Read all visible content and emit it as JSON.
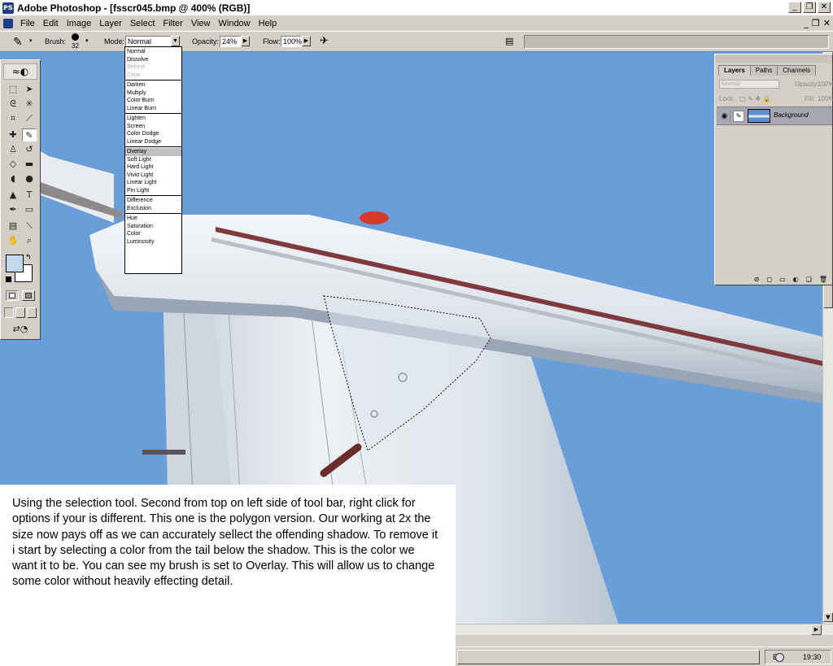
{
  "window": {
    "title": "Adobe Photoshop - [fsscr045.bmp @ 400% (RGB)]",
    "app_icon": "photoshop-icon",
    "controls": [
      "_",
      "❐",
      "✕"
    ]
  },
  "menubar": {
    "items": [
      "File",
      "Edit",
      "Image",
      "Layer",
      "Select",
      "Filter",
      "View",
      "Window",
      "Help"
    ],
    "doc_controls": [
      "_",
      "❐",
      "✕"
    ]
  },
  "options": {
    "brush_label": "Brush:",
    "brush_size": "32",
    "mode_label": "Mode:",
    "mode_value": "Normal",
    "opacity_label": "Opacity:",
    "opacity_value": "24%",
    "flow_label": "Flow:",
    "flow_value": "100%"
  },
  "blend_modes": {
    "groups": [
      [
        {
          "label": "Normal",
          "state": "normal"
        },
        {
          "label": "Dissolve",
          "state": "normal"
        },
        {
          "label": "Behind",
          "state": "disabled"
        },
        {
          "label": "Clear",
          "state": "disabled"
        }
      ],
      [
        {
          "label": "Darken",
          "state": "normal"
        },
        {
          "label": "Multiply",
          "state": "normal"
        },
        {
          "label": "Color Burn",
          "state": "normal"
        },
        {
          "label": "Linear Burn",
          "state": "normal"
        }
      ],
      [
        {
          "label": "Lighten",
          "state": "normal"
        },
        {
          "label": "Screen",
          "state": "normal"
        },
        {
          "label": "Color Dodge",
          "state": "normal"
        },
        {
          "label": "Linear Dodge",
          "state": "normal"
        }
      ],
      [
        {
          "label": "Overlay",
          "state": "selected"
        },
        {
          "label": "Soft Light",
          "state": "normal"
        },
        {
          "label": "Hard Light",
          "state": "normal"
        },
        {
          "label": "Vivid Light",
          "state": "normal"
        },
        {
          "label": "Linear Light",
          "state": "normal"
        },
        {
          "label": "Pin Light",
          "state": "normal"
        }
      ],
      [
        {
          "label": "Difference",
          "state": "normal"
        },
        {
          "label": "Exclusion",
          "state": "normal"
        }
      ],
      [
        {
          "label": "Hue",
          "state": "normal"
        },
        {
          "label": "Saturation",
          "state": "normal"
        },
        {
          "label": "Color",
          "state": "normal"
        },
        {
          "label": "Luminosity",
          "state": "normal"
        }
      ]
    ]
  },
  "layers_palette": {
    "tabs": [
      "Layers",
      "Paths",
      "Channels"
    ],
    "blend_value": "Normal",
    "opacity_label": "Opacity:",
    "opacity_value": "100%",
    "lock_label": "Lock:",
    "fill_label": "Fill:",
    "fill_value": "100%",
    "layers": [
      {
        "name": "Background"
      }
    ]
  },
  "colors": {
    "foreground": "#c3d8ec",
    "background": "#ffffff",
    "sky": "#6a9ed8"
  },
  "caption": {
    "text": "Using the selection tool. Second from top on left side of tool bar, right click for options if your is different. This one is the polygon version. Our working at 2x the size now pays off as we can accurately sellect the offending shadow. To remove it i start by selecting a color from the tail below the shadow. This is the color we want it to be. You can see my brush is set to Overlay. This will allow us to change some color without heavily effecting detail."
  },
  "taskbar": {
    "language": "EN",
    "clock": "19:30"
  }
}
